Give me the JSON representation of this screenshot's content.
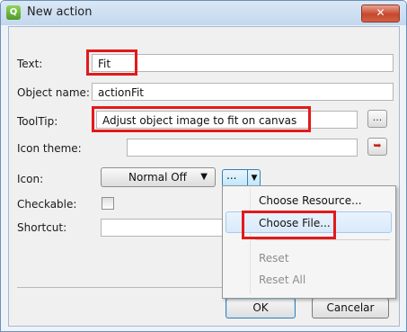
{
  "window": {
    "title": "New action",
    "close_symbol": "✕"
  },
  "form": {
    "text_label": "Text:",
    "text_value": "Fit",
    "object_name_label": "Object name:",
    "object_name_value": "actionFit",
    "tooltip_label": "ToolTip:",
    "tooltip_value": "Adjust object image to fit on canvas",
    "tooltip_more": "...",
    "icon_theme_label": "Icon theme:",
    "icon_theme_value": "",
    "icon_label": "Icon:",
    "icon_mode": "Normal Off",
    "icon_more": "...",
    "checkable_label": "Checkable:",
    "shortcut_label": "Shortcut:"
  },
  "menu": {
    "items": [
      "Choose Resource...",
      "Choose File...",
      "Reset",
      "Reset All"
    ]
  },
  "buttons": {
    "ok": "OK",
    "cancel": "Cancelar"
  },
  "colors": {
    "highlight": "#e21a1a",
    "title_bar": "#c3d7ee"
  }
}
